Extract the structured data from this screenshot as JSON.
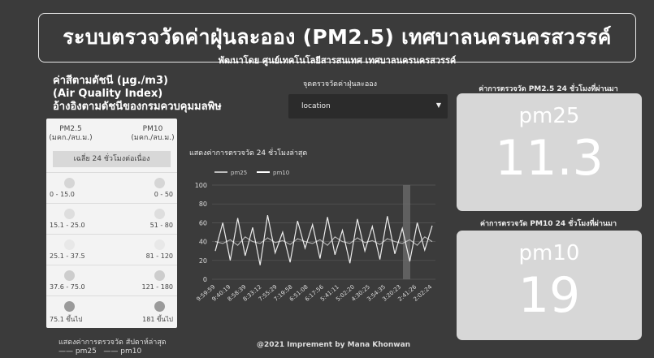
{
  "header": {
    "title": "ระบบตรวจวัดค่าฝุ่นละออง (PM2.5) เทศบาลนครนครสวรรค์",
    "subtitle": "พัฒนาโดย ศูนย์เทคโนโลยีสารสนเทศ เทศบาลนครนครสวรรค์"
  },
  "aqi": {
    "line1": "ค่าสีตามดัชนี   (µg./m3)",
    "line2": "(Air Quality Index)",
    "line3": "อ้างอิงตามดัชนีของกรมควบคุมมลพิษ"
  },
  "legend_card": {
    "pm25_label": "PM2.5",
    "pm10_label": "PM10",
    "unit": "(มคก./ลบ.ม.)",
    "avg_label": "เฉลี่ย 24 ชั่วโมงต่อเนื่อง",
    "rows": [
      {
        "pm25": "0 - 15.0",
        "pm10": "0 - 50",
        "color": "#d6d6d6"
      },
      {
        "pm25": "15.1 - 25.0",
        "pm10": "51 - 80",
        "color": "#dedede"
      },
      {
        "pm25": "25.1 - 37.5",
        "pm10": "81 - 120",
        "color": "#e8e8e8"
      },
      {
        "pm25": "37.6 - 75.0",
        "pm10": "121 - 180",
        "color": "#cdcdcd"
      },
      {
        "pm25": "75.1 ขึ้นไป",
        "pm10": "181 ขึ้นไป",
        "color": "#9a9a9a"
      }
    ]
  },
  "bottom_legend": {
    "title": "แสดงค่าการตรวจวัด สัปดาห์ล่าสุด",
    "series1": "pm25",
    "series2": "pm10"
  },
  "station": {
    "label": "จุดตรวจวัดค่าฝุ่นละออง",
    "selected": "location",
    "caret_icon": "caret-down-icon"
  },
  "chart_title": "แสดงค่าการตรวจวัด 24 ชั่วโมงล่าสุด",
  "chart_data": {
    "type": "line",
    "series": [
      {
        "name": "pm25",
        "color": "#bdbdbd",
        "values": [
          40,
          38,
          42,
          36,
          45,
          40,
          38,
          44,
          39,
          41,
          37,
          43,
          40,
          38,
          42,
          36,
          45,
          40,
          38,
          44,
          39,
          41,
          37,
          43,
          40,
          38,
          42,
          36,
          45,
          40
        ]
      },
      {
        "name": "pm10",
        "color": "#ffffff",
        "values": [
          30,
          60,
          20,
          65,
          25,
          55,
          15,
          68,
          28,
          50,
          18,
          62,
          33,
          58,
          22,
          66,
          26,
          52,
          17,
          64,
          30,
          56,
          21,
          67,
          27,
          54,
          19,
          60,
          31,
          57
        ]
      }
    ],
    "x_ticks": [
      "9:59:59",
      "9:40:19",
      "8:58:39",
      "8:33:12",
      "7:55:29",
      "7:19:58",
      "6:51:08",
      "6:17:56",
      "5:41:11",
      "5:02:20",
      "4:30:25",
      "3:54:35",
      "3:20:23",
      "2:41:26",
      "2:02:24"
    ],
    "y_ticks": [
      "0",
      "20",
      "40",
      "60",
      "80",
      "100"
    ],
    "ylim": [
      0,
      100
    ]
  },
  "pm25_card": {
    "title": "ค่าการตรวจวัด PM2.5 24 ชั่วโมงที่ผ่านมา",
    "name": "pm25",
    "value": "11.3"
  },
  "pm10_card": {
    "title": "ค่าการตรวจวัด PM10 24 ชั่วโมงที่ผ่านมา",
    "name": "pm10",
    "value": "19"
  },
  "footer": "@2021 Imprement by Mana Khonwan"
}
